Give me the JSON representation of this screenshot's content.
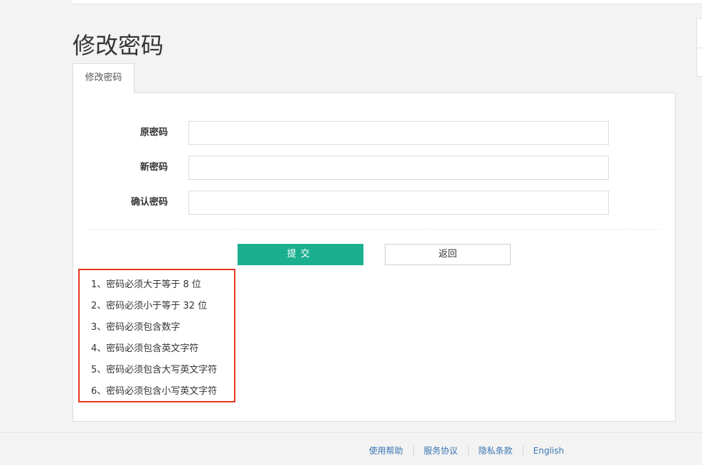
{
  "page": {
    "title": "修改密码"
  },
  "tabs": [
    {
      "label": "修改密码"
    }
  ],
  "form": {
    "fields": [
      {
        "label": "原密码",
        "value": ""
      },
      {
        "label": "新密码",
        "value": ""
      },
      {
        "label": "确认密码",
        "value": ""
      }
    ],
    "submit_label": "提交",
    "back_label": "返回"
  },
  "rules": [
    "1、密码必须大于等于 8 位",
    "2、密码必须小于等于 32 位",
    "3、密码必须包含数字",
    "4、密码必须包含英文字符",
    "5、密码必须包含大写英文字符",
    "6、密码必须包含小写英文字符"
  ],
  "footer": {
    "links": [
      "使用帮助",
      "服务协议",
      "隐私条款",
      "English"
    ]
  },
  "colors": {
    "primary": "#1aaf8e",
    "highlight_border": "#e8351e",
    "link": "#3a76b5"
  }
}
